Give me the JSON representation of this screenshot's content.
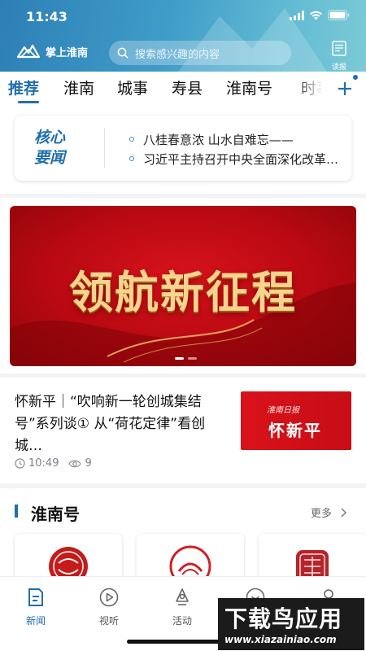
{
  "status_bar": {
    "time": "11:43"
  },
  "header": {
    "app_name": "掌上淮南",
    "search_placeholder": "搜索感兴趣的内容",
    "epaper_label": "读报"
  },
  "tabs": [
    {
      "label": "推荐",
      "active": true
    },
    {
      "label": "淮南",
      "active": false
    },
    {
      "label": "城事",
      "active": false
    },
    {
      "label": "寿县",
      "active": false
    },
    {
      "label": "淮南号",
      "active": false
    },
    {
      "label": "时事",
      "active": false
    }
  ],
  "core_news": {
    "title_line1": "核心",
    "title_line2": "要闻",
    "items": [
      "八桂春意浓 山水自难忘——",
      "习近平主持召开中央全面深化改革委员会"
    ]
  },
  "banner": {
    "text": "领航新征程",
    "slide_count": 2,
    "active_slide": 1
  },
  "news_item": {
    "title": "怀新平｜“吹响新一轮创城集结号”系列谈① 从“荷花定律”看创城…",
    "time": "10:49",
    "views": "9",
    "thumb_line1": "淮南日报",
    "thumb_line2": "怀新平"
  },
  "huainan_hao": {
    "title": "淮南号",
    "more_label": "更多"
  },
  "tabbar": [
    {
      "label": "新闻",
      "icon": "news-icon",
      "active": true
    },
    {
      "label": "视听",
      "icon": "play-icon",
      "active": false
    },
    {
      "label": "活动",
      "icon": "activity-icon",
      "active": false
    },
    {
      "label": "",
      "icon": "service-icon",
      "active": false
    },
    {
      "label": "",
      "icon": "profile-icon",
      "active": false
    }
  ],
  "watermark": {
    "text": "下载鸟应用",
    "url": "www.xiazainiao.com"
  },
  "colors": {
    "brand_blue": "#1f6fae",
    "banner_red": "#c70d15",
    "banner_gold": "#f6d48e"
  }
}
